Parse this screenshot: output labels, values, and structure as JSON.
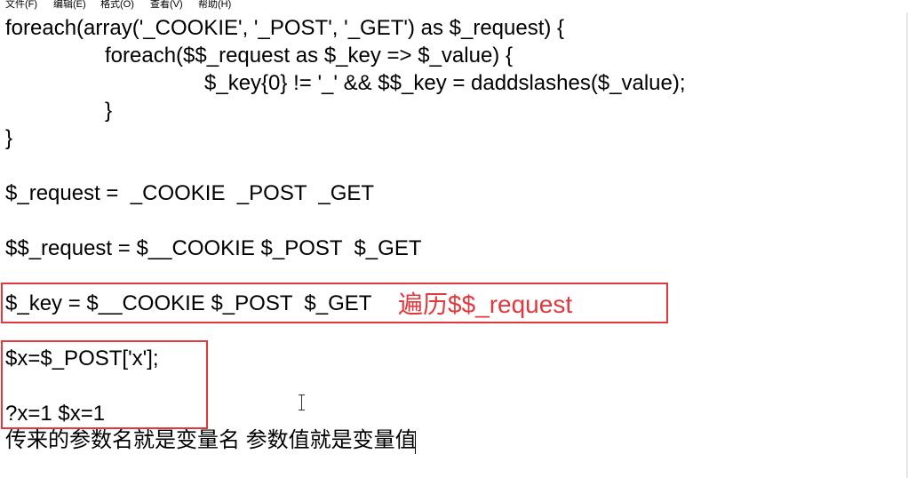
{
  "menu": {
    "items": [
      {
        "label": "文件(F)"
      },
      {
        "label": "编辑(E)"
      },
      {
        "label": "格式(O)"
      },
      {
        "label": "查看(V)"
      },
      {
        "label": "帮助(H)"
      }
    ]
  },
  "editor": {
    "lines": [
      "foreach(array('_COOKIE', '_POST', '_GET') as $_request) {",
      "foreach($$_request as $_key => $_value) {",
      "$_key{0} != '_' && $$_key = daddslashes($_value);",
      "}",
      "}",
      "$_request =  _COOKIE  _POST  _GET",
      "$$_request = $__COOKIE $_POST  $_GET",
      "$_key = $__COOKIE $_POST  $_GET",
      "$x=$_POST['x'];",
      "?x=1 $x=1",
      "传来的参数名就是变量名 参数值就是变量值"
    ],
    "annotation": "遍历$$_request",
    "highlight_color": "#e2383e"
  }
}
